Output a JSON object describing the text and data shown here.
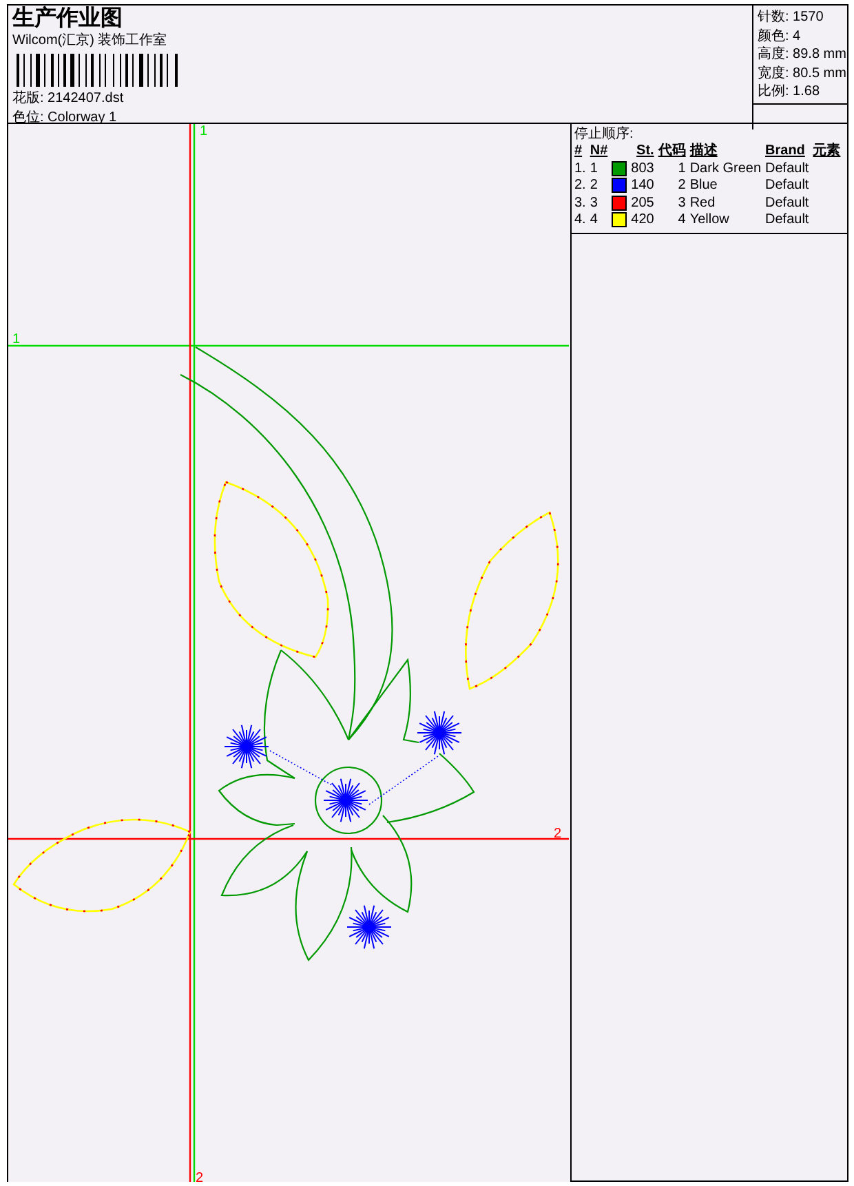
{
  "header": {
    "title": "生产作业图",
    "company": "Wilcom(汇京) 装饰工作室",
    "design_file": "花版: 2142407.dst",
    "colorway": "色位: Colorway 1"
  },
  "stats": [
    "针数: 1570",
    "颜色: 4",
    "高度: 89.8 mm",
    "宽度: 80.5 mm",
    "比例: 1.68"
  ],
  "stop_sequence": {
    "title": "停止顺序:",
    "columns": [
      "#",
      "N#",
      "St.",
      "代码",
      "描述",
      "Brand",
      "元素"
    ],
    "rows": [
      {
        "index": "1.",
        "number": "1",
        "color": "#009900",
        "stitches": "803",
        "code": "1",
        "description": "Dark Green",
        "brand": "Default"
      },
      {
        "index": "2.",
        "number": "2",
        "color": "#0000ff",
        "stitches": "140",
        "code": "2",
        "description": "Blue",
        "brand": "Default"
      },
      {
        "index": "3.",
        "number": "3",
        "color": "#ff0000",
        "stitches": "205",
        "code": "3",
        "description": "Red",
        "brand": "Default"
      },
      {
        "index": "4.",
        "number": "4",
        "color": "#ffff00",
        "stitches": "420",
        "code": "4",
        "description": "Yellow",
        "brand": "Default"
      }
    ]
  },
  "canvas": {
    "markers": [
      {
        "kind": "start-top",
        "label": "1",
        "color": "#00dd00"
      },
      {
        "kind": "start-left",
        "label": "1",
        "color": "#00dd00"
      },
      {
        "kind": "end-right",
        "label": "2",
        "color": "#ff0000"
      },
      {
        "kind": "end-bottom",
        "label": "2",
        "color": "#ff0000"
      }
    ]
  }
}
